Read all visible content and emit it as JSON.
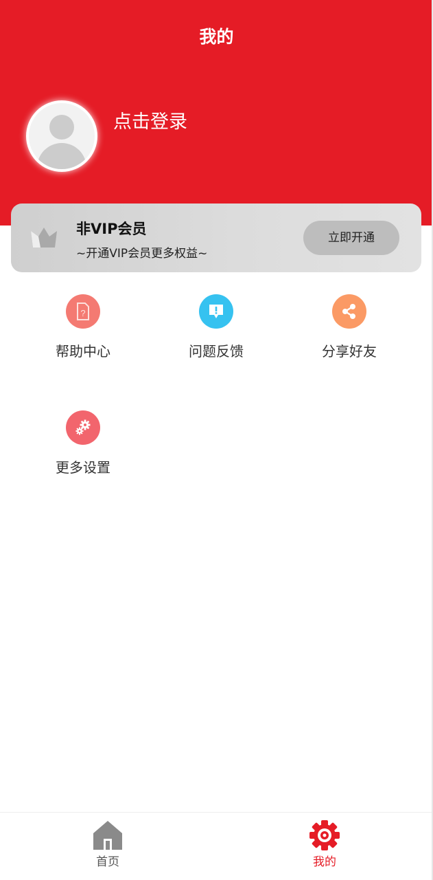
{
  "header": {
    "title": "我的",
    "login_text": "点击登录"
  },
  "vip": {
    "title": "非VIP会员",
    "subtitle": "~开通VIP会员更多权益~",
    "button_label": "立即开通"
  },
  "menu": [
    {
      "label": "帮助中心",
      "icon": "help-document-icon",
      "color": "#f47a72"
    },
    {
      "label": "问题反馈",
      "icon": "feedback-icon",
      "color": "#36c2f0"
    },
    {
      "label": "分享好友",
      "icon": "share-icon",
      "color": "#fb9a65"
    },
    {
      "label": "更多设置",
      "icon": "settings-gears-icon",
      "color": "#f2656d"
    }
  ],
  "tabbar": {
    "items": [
      {
        "label": "首页",
        "icon": "home-icon",
        "active": false
      },
      {
        "label": "我的",
        "icon": "gear-target-icon",
        "active": true
      }
    ]
  },
  "colors": {
    "brand": "#e51c26",
    "active_tab": "#e51c26",
    "inactive_tab": "#8a8a8a"
  }
}
